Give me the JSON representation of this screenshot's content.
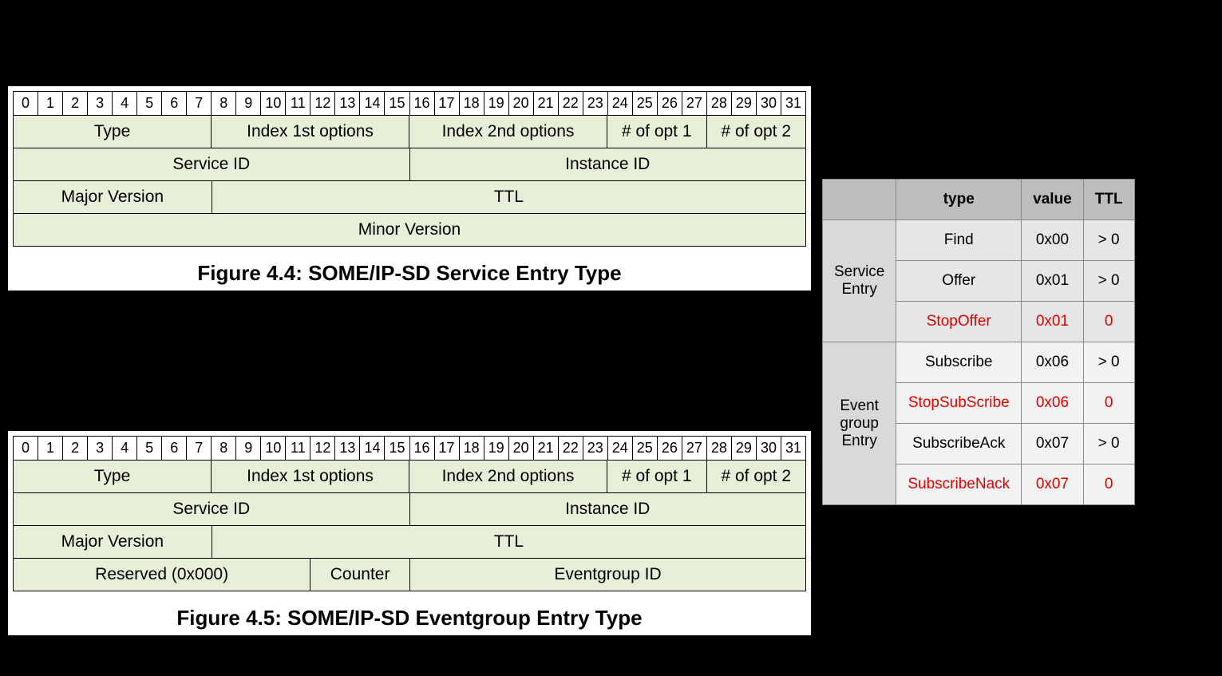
{
  "bit_numbers": [
    "0",
    "1",
    "2",
    "3",
    "4",
    "5",
    "6",
    "7",
    "8",
    "9",
    "10",
    "11",
    "12",
    "13",
    "14",
    "15",
    "16",
    "17",
    "18",
    "19",
    "20",
    "21",
    "22",
    "23",
    "24",
    "25",
    "26",
    "27",
    "28",
    "29",
    "30",
    "31"
  ],
  "fig44": {
    "caption": "Figure 4.4: SOME/IP-SD Service Entry Type",
    "row1": {
      "type": "Type",
      "idx1": "Index 1st options",
      "idx2": "Index 2nd options",
      "opt1": "# of opt 1",
      "opt2": "# of opt 2"
    },
    "row2": {
      "service_id": "Service ID",
      "instance_id": "Instance ID"
    },
    "row3": {
      "major_version": "Major Version",
      "ttl": "TTL"
    },
    "row4": {
      "minor_version": "Minor Version"
    }
  },
  "fig45": {
    "caption": "Figure 4.5: SOME/IP-SD Eventgroup Entry Type",
    "row1": {
      "type": "Type",
      "idx1": "Index 1st options",
      "idx2": "Index 2nd options",
      "opt1": "# of opt 1",
      "opt2": "# of opt 2"
    },
    "row2": {
      "service_id": "Service ID",
      "instance_id": "Instance ID"
    },
    "row3": {
      "major_version": "Major Version",
      "ttl": "TTL"
    },
    "row4": {
      "reserved": "Reserved (0x000)",
      "counter": "Counter",
      "eventgroup_id": "Eventgroup ID"
    }
  },
  "types_table": {
    "headers": {
      "blank": "",
      "type": "type",
      "value": "value",
      "ttl": "TTL"
    },
    "groups": [
      {
        "group_label": "Service\nEntry",
        "rows": [
          {
            "type": "Find",
            "value": "0x00",
            "ttl": "> 0",
            "red": false
          },
          {
            "type": "Offer",
            "value": "0x01",
            "ttl": "> 0",
            "red": false
          },
          {
            "type": "StopOffer",
            "value": "0x01",
            "ttl": "0",
            "red": true
          }
        ],
        "row_class": "row-svc"
      },
      {
        "group_label": "Event\ngroup\nEntry",
        "rows": [
          {
            "type": "Subscribe",
            "value": "0x06",
            "ttl": "> 0",
            "red": false
          },
          {
            "type": "StopSubScribe",
            "value": "0x06",
            "ttl": "0",
            "red": true
          },
          {
            "type": "SubscribeAck",
            "value": "0x07",
            "ttl": "> 0",
            "red": false
          },
          {
            "type": "SubscribeNack",
            "value": "0x07",
            "ttl": "0",
            "red": true
          }
        ],
        "row_class": "row-evt"
      }
    ]
  }
}
